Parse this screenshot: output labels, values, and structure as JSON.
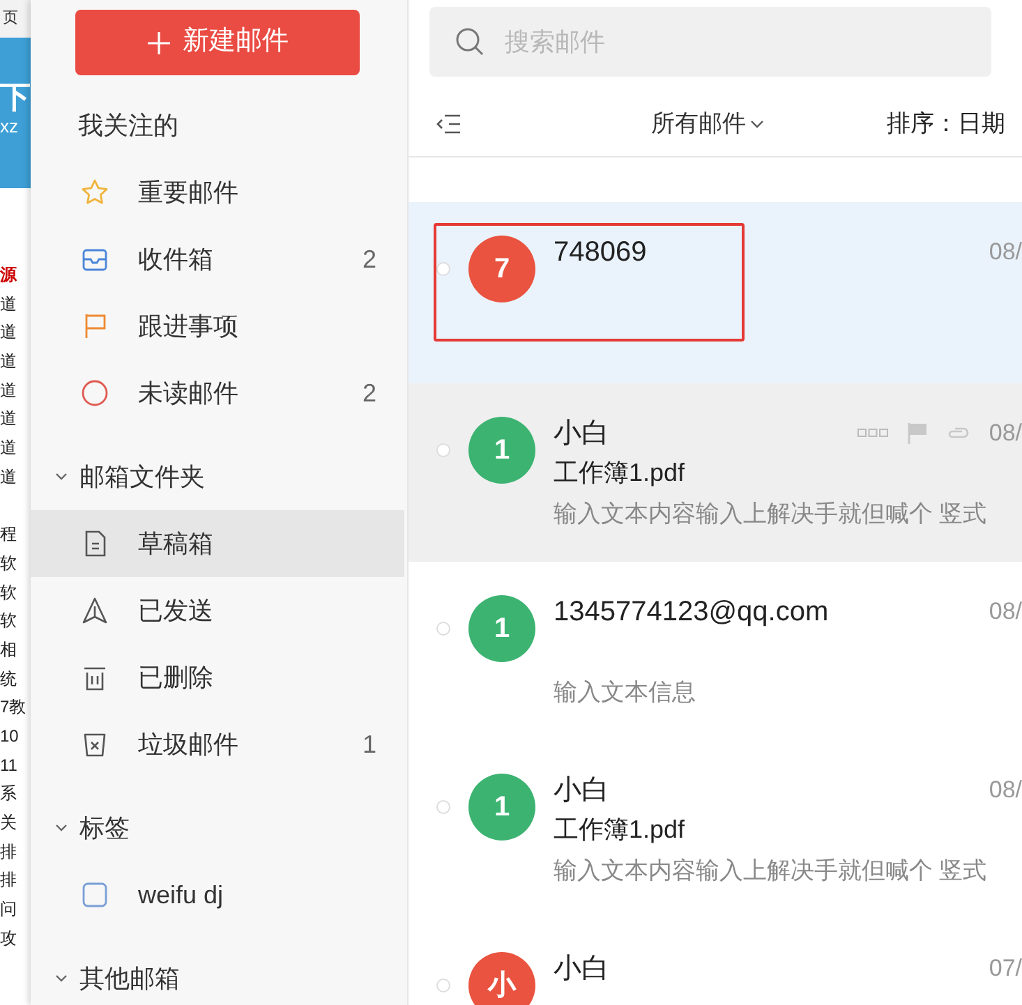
{
  "background_window": {
    "top_text": "页",
    "banner": [
      "下",
      "xz"
    ],
    "lines": [
      {
        "text": "源",
        "emphasis": true,
        "gap_before": false
      },
      {
        "text": "道",
        "emphasis": false,
        "gap_before": false
      },
      {
        "text": "道",
        "emphasis": false,
        "gap_before": false
      },
      {
        "text": "道",
        "emphasis": false,
        "gap_before": false
      },
      {
        "text": "道",
        "emphasis": false,
        "gap_before": false
      },
      {
        "text": "道",
        "emphasis": false,
        "gap_before": false
      },
      {
        "text": "道",
        "emphasis": false,
        "gap_before": false
      },
      {
        "text": "道",
        "emphasis": false,
        "gap_before": false
      },
      {
        "text": "程",
        "emphasis": false,
        "gap_before": true
      },
      {
        "text": "软",
        "emphasis": false,
        "gap_before": false
      },
      {
        "text": "软",
        "emphasis": false,
        "gap_before": false
      },
      {
        "text": "软",
        "emphasis": false,
        "gap_before": false
      },
      {
        "text": "相",
        "emphasis": false,
        "gap_before": false
      },
      {
        "text": "统",
        "emphasis": false,
        "gap_before": false
      },
      {
        "text": "7教",
        "emphasis": false,
        "gap_before": false
      },
      {
        "text": "10",
        "emphasis": false,
        "gap_before": false
      },
      {
        "text": "11",
        "emphasis": false,
        "gap_before": false
      },
      {
        "text": "系",
        "emphasis": false,
        "gap_before": false
      },
      {
        "text": "关",
        "emphasis": false,
        "gap_before": false
      },
      {
        "text": "排",
        "emphasis": false,
        "gap_before": false
      },
      {
        "text": "排",
        "emphasis": false,
        "gap_before": false
      },
      {
        "text": "问",
        "emphasis": false,
        "gap_before": false
      },
      {
        "text": "攻",
        "emphasis": false,
        "gap_before": false
      }
    ]
  },
  "sidebar": {
    "new_button": "新建邮件",
    "sections": [
      {
        "title": "我关注的",
        "items": [
          {
            "kind": "star",
            "label": "重要邮件",
            "selected": false
          },
          {
            "kind": "inbox",
            "label": "收件箱",
            "count": "2",
            "selected": false
          },
          {
            "kind": "flag",
            "label": "跟进事项",
            "selected": false
          },
          {
            "kind": "unread",
            "label": "未读邮件",
            "count": "2",
            "selected": false
          }
        ]
      },
      {
        "title": "邮箱文件夹",
        "expanded": true,
        "items": [
          {
            "kind": "draft",
            "label": "草稿箱",
            "selected": true
          },
          {
            "kind": "sent",
            "label": "已发送",
            "selected": false
          },
          {
            "kind": "trash",
            "label": "已删除",
            "selected": false
          },
          {
            "kind": "junk",
            "label": "垃圾邮件",
            "count": "1",
            "selected": false
          }
        ]
      },
      {
        "title": "标签",
        "expanded": true,
        "items": [
          {
            "kind": "tag",
            "label": "weifu dj",
            "color": "#7a9fd6",
            "selected": false
          }
        ]
      },
      {
        "title": "其他邮箱",
        "expanded": true
      }
    ]
  },
  "mail_list": {
    "search": {
      "placeholder": "搜索邮件"
    },
    "filter": "所有邮件",
    "sort": "排序：日期",
    "messages": [
      {
        "avatar": "7",
        "color": "#e9533f",
        "sender": "748069",
        "date": "08/",
        "selected": true,
        "hovered": false,
        "marked": true
      },
      {
        "avatar": "1",
        "color": "#3cb371",
        "sender": "小白",
        "subject": "工作簿1.pdf",
        "preview": "输入文本内容输入上解决手就但喊个 竖式",
        "date": "08/",
        "selected": false,
        "hovered": true,
        "marked": false
      },
      {
        "avatar": "1",
        "color": "#3cb371",
        "sender": "1345774123@qq.com",
        "preview": "输入文本信息",
        "date": "08/",
        "selected": false,
        "hovered": false,
        "marked": false
      },
      {
        "avatar": "1",
        "color": "#3cb371",
        "sender": "小白",
        "subject": "工作簿1.pdf",
        "preview": "输入文本内容输入上解决手就但喊个 竖式",
        "date": "08/",
        "selected": false,
        "hovered": false,
        "marked": false
      },
      {
        "avatar": "小",
        "color": "#e9533f",
        "sender": "小白",
        "date": "07/",
        "selected": false,
        "hovered": false,
        "marked": false
      }
    ]
  }
}
